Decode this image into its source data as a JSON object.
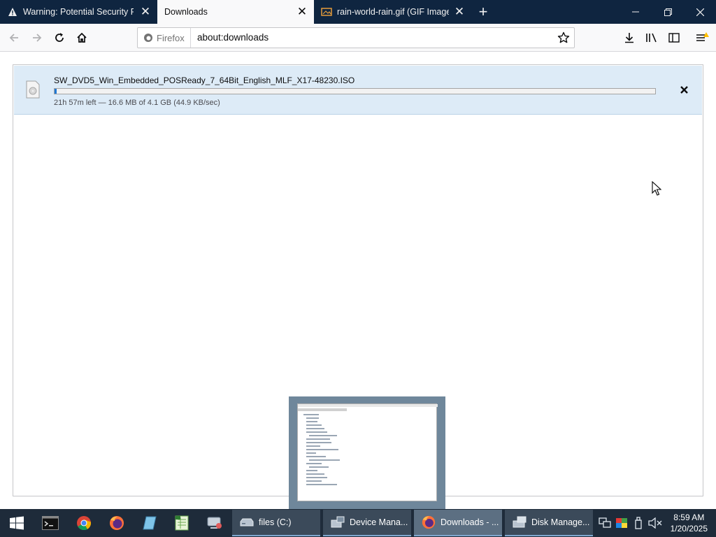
{
  "tabs": [
    {
      "title": "Warning: Potential Security Risk Ahead",
      "icon": "warning-icon"
    },
    {
      "title": "Downloads",
      "icon": ""
    },
    {
      "title": "rain-world-rain.gif (GIF Image, ...)",
      "icon": "image-icon"
    }
  ],
  "urlbar": {
    "identity_label": "Firefox",
    "url": "about:downloads"
  },
  "download": {
    "filename": "SW_DVD5_Win_Embedded_POSReady_7_64Bit_English_MLF_X17-48230.ISO",
    "status": "21h 57m left — 16.6 MB of 4.1 GB (44.9 KB/sec)",
    "progress_fraction": 0.004
  },
  "taskbar": {
    "pinned": [
      "start-icon",
      "terminal-icon",
      "chrome-icon",
      "firefox-icon",
      "notepad-icon",
      "spreadsheet-icon",
      "remote-desktop-icon"
    ],
    "tasks": [
      {
        "label": "files (C:)",
        "active": false
      },
      {
        "label": "Device Mana...",
        "active": false
      },
      {
        "label": "Downloads - ...",
        "active": true
      },
      {
        "label": "Disk Manage...",
        "active": false
      }
    ],
    "clock_time": "8:59 AM",
    "clock_date": "1/20/2025"
  },
  "colors": {
    "tabbar": "#0f2540",
    "accent": "#1f78d4",
    "download_bg": "#ddebf7",
    "taskbar": "#1e2b3a"
  }
}
